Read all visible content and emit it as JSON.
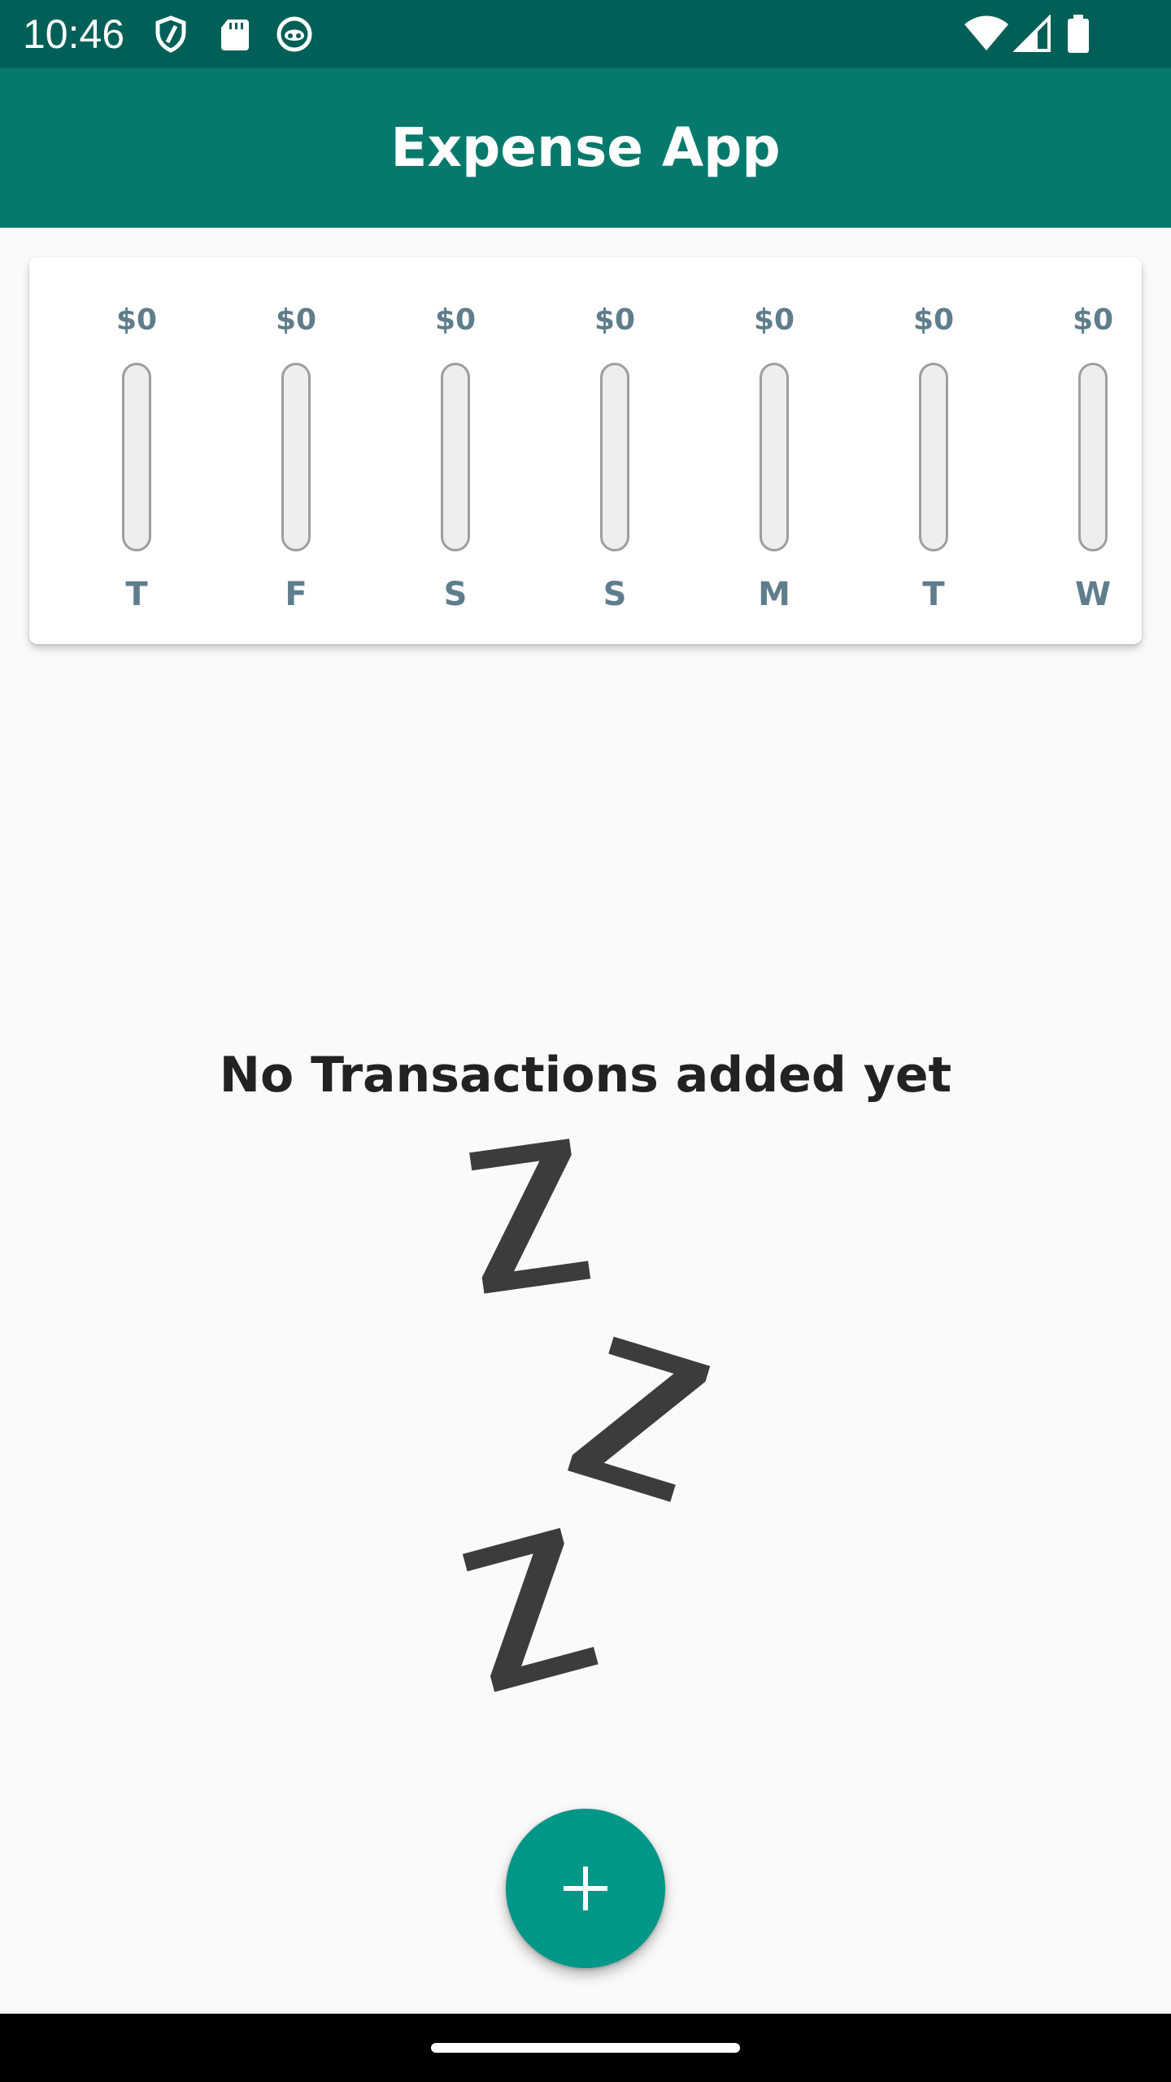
{
  "status_bar": {
    "time": "10:46",
    "left_icons": [
      "shield-icon",
      "sd-card-icon",
      "app-notification-icon"
    ],
    "right_icons": [
      "wifi-icon",
      "cell-signal-icon",
      "battery-icon"
    ]
  },
  "app_bar": {
    "title": "Expense App"
  },
  "chart": {
    "days": [
      {
        "label": "T",
        "amount": "$0",
        "fraction": 0
      },
      {
        "label": "F",
        "amount": "$0",
        "fraction": 0
      },
      {
        "label": "S",
        "amount": "$0",
        "fraction": 0
      },
      {
        "label": "S",
        "amount": "$0",
        "fraction": 0
      },
      {
        "label": "M",
        "amount": "$0",
        "fraction": 0
      },
      {
        "label": "T",
        "amount": "$0",
        "fraction": 0
      },
      {
        "label": "W",
        "amount": "$0",
        "fraction": 0
      }
    ]
  },
  "empty_state": {
    "message": "No Transactions added yet",
    "illustration": "sleeping-zzz-icon"
  },
  "fab": {
    "icon": "plus-icon"
  },
  "colors": {
    "status_bar": "#005f56",
    "app_bar": "#057a6c",
    "fab": "#009688",
    "chart_text": "#5f7d8c",
    "background": "#fafafa"
  }
}
